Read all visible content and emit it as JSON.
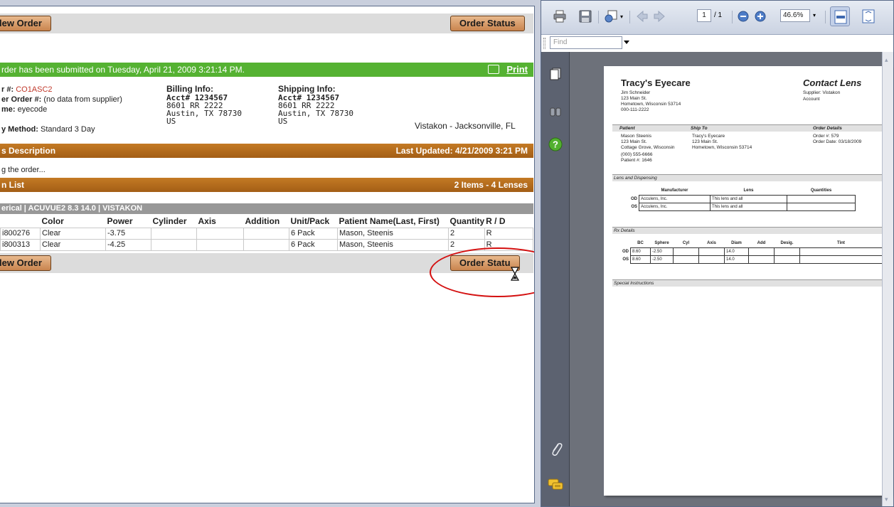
{
  "left_pane": {
    "new_order_label": "New Order",
    "new_order_visible": "lew Order",
    "order_status_label": "Order Status",
    "order_status_visible_bottom": "Order Statu",
    "confirmation_text": "rder has been submitted on Tuesday, April 21, 2009 3:21:14 PM.",
    "print_label": "Print",
    "order": {
      "order_label": "r #:",
      "order_number": "CO1ASC2",
      "supplier_order_label": "er Order #:",
      "supplier_order_value": "(no data from supplier)",
      "name_label": "me:",
      "name_value": "eyecode",
      "delivery_label": "y Method:",
      "delivery_value": "Standard 3 Day"
    },
    "billing": {
      "title": "Billing Info:",
      "acct": "Acct# 1234567",
      "line1": "8601 RR 2222",
      "line2": "Austin, TX 78730",
      "country": "US"
    },
    "shipping": {
      "title": "Shipping Info:",
      "acct": "Acct# 1234567",
      "line1": "8601 RR 2222",
      "line2": "Austin, TX 78730",
      "country": "US"
    },
    "supplier_location": "Vistakon - Jacksonville, FL",
    "status_section": {
      "title": "s Description",
      "last_updated": "Last Updated: 4/21/2009 3:21 PM",
      "text": "g the order..."
    },
    "item_section": {
      "title": "n List",
      "summary": "2 Items - 4 Lenses"
    },
    "product_line": "erical | ACUVUE2 8.3 14.0 | VISTAKON",
    "table_headers": [
      "",
      "Color",
      "Power",
      "Cylinder",
      "Axis",
      "Addition",
      "Unit/Pack",
      "Patient Name(Last, First)",
      "Quantity",
      "R / D"
    ],
    "rows": [
      [
        "i800276",
        "Clear",
        "-3.75",
        "",
        "",
        "",
        "6 Pack",
        "Mason, Steenis",
        "2",
        "R"
      ],
      [
        "i800313",
        "Clear",
        "-4.25",
        "",
        "",
        "",
        "6 Pack",
        "Mason, Steenis",
        "2",
        "R"
      ]
    ]
  },
  "pdf_viewer": {
    "page_current": "1",
    "page_total": "/ 1",
    "zoom": "46.6%",
    "find_placeholder": "Find",
    "document": {
      "store_name": "Tracy's Eyecare",
      "store_contact": "Jim Schneider",
      "store_addr1": "123 Main St.",
      "store_addr2": "Hometown, Wisconsin 53714",
      "store_phone": "000-111-2222",
      "doc_title": "Contact Lens",
      "supplier_line": "Supplier:  Vistakon",
      "account_line": "Account",
      "patient_head": "Patient",
      "shipto_head": "Ship To",
      "orderdetails_head": "Order Details",
      "patient_name": "Mason Steenis",
      "patient_addr1": "123 Main St.",
      "patient_addr2": "Cottage Grove, Wisconsin",
      "patient_phone": "(000) 555-6666",
      "patient_num": "Patient #:  1646",
      "ship_name": "Tracy's Eyecare",
      "ship_addr1": "123 Main St.",
      "ship_addr2": "Hometown, Wisconsin 53714",
      "order_num": "Order #:     579",
      "order_date": "Order Date:  03/18/2009",
      "lens_head": "Lens and Dispensing",
      "lens_cols": [
        "Manufacturer",
        "Lens",
        "Quantities"
      ],
      "lens_rows": [
        [
          "OD",
          "Acculens, Inc.",
          "This lens and all",
          ""
        ],
        [
          "OS",
          "Acculens, Inc.",
          "This lens and all",
          ""
        ]
      ],
      "rx_head": "Rx Details",
      "rx_cols": [
        "",
        "BC",
        "Sphere",
        "Cyl",
        "Axis",
        "Diam",
        "Add",
        "Desig.",
        "Tint"
      ],
      "rx_rows": [
        [
          "OD",
          "8.60",
          "-2.50",
          "",
          "",
          "14.0",
          "",
          "",
          ""
        ],
        [
          "OS",
          "8.60",
          "-2.50",
          "",
          "",
          "14.0",
          "",
          "",
          ""
        ]
      ],
      "special_head": "Special Instructions"
    }
  },
  "colors": {
    "green_bar": "#55b232",
    "section_brown": "#b06a1c",
    "order_number_red": "#c0392b",
    "annotation_red": "#d41010"
  }
}
